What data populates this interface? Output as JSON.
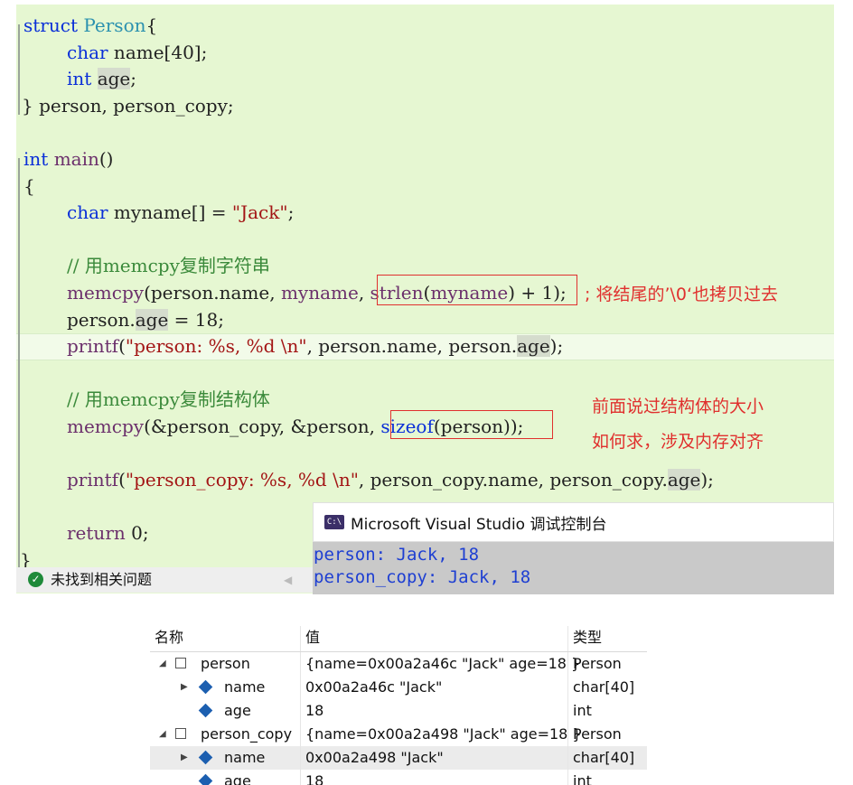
{
  "code": {
    "l1": {
      "kw": "struct",
      "name": "Person",
      "rest": "{"
    },
    "l2": {
      "ty": "char",
      "rest": " name[40];"
    },
    "l3": {
      "ty": "int",
      "var": "age",
      "rest": ";"
    },
    "l4": "} person, person_copy;",
    "l5": {
      "ty": "int",
      "fn": "main",
      "rest": "()"
    },
    "l6": "{",
    "l7": {
      "ty": "char",
      "rest1": " myname[] = ",
      "str": "\"Jack\"",
      "rest2": ";"
    },
    "l8": "// 用memcpy复制字符串",
    "l9": {
      "fn": "memcpy",
      "a": "(person.name, ",
      "b": "myname",
      "c": ", ",
      "boxed1": "strlen",
      "boxed2": "(",
      "boxed3": "myname",
      "boxed4": ") + 1",
      "d": ");"
    },
    "l10": {
      "a": "person.",
      "var": "age",
      "b": " = 18;"
    },
    "l11": {
      "fn": "printf",
      "a": "(",
      "str": "\"person: %s, %d \\n\"",
      "b": ", person.name, person.",
      "var": "age",
      "c": ");"
    },
    "l12": "// 用memcpy复制结构体",
    "l13": {
      "fn": "memcpy",
      "a": "(&person_copy, &person, ",
      "boxed1": "sizeof",
      "boxed2": "(person)",
      "b": ");"
    },
    "l14": {
      "fn": "printf",
      "a": "(",
      "str": "\"person_copy: %s, %d \\n\"",
      "b": ", person_copy.name, person_copy.",
      "var": "age",
      "c": ");"
    },
    "l15": {
      "kw": "return",
      "rest": " 0;"
    },
    "l16": "}"
  },
  "notes": {
    "n1": "; 将结尾的’\\0‘也拷贝过去",
    "n2": "前面说过结构体的大小",
    "n3": "如何求，涉及内存对齐"
  },
  "status": {
    "text": "未找到相关问题"
  },
  "console": {
    "title": "Microsoft Visual Studio 调试控制台",
    "line1": "person: Jack, 18",
    "line2": "person_copy: Jack, 18"
  },
  "watch": {
    "headers": [
      "名称",
      "值",
      "类型"
    ],
    "rows": [
      {
        "name": "person",
        "value": "{name=0x00a2a46c \"Jack\" age=18 }",
        "type": "Person"
      },
      {
        "name": "name",
        "value": "0x00a2a46c \"Jack\"",
        "type": "char[40]"
      },
      {
        "name": "age",
        "value": "18",
        "type": "int"
      },
      {
        "name": "person_copy",
        "value": "{name=0x00a2a498 \"Jack\" age=18 }",
        "type": "Person"
      },
      {
        "name": "name",
        "value": "0x00a2a498 \"Jack\"",
        "type": "char[40]"
      },
      {
        "name": "age",
        "value": "18",
        "type": "int"
      }
    ]
  },
  "colors": {
    "editor_bg": "#e6f7d2",
    "annotation": "#e0302e",
    "console_text": "#1e3fd2"
  }
}
